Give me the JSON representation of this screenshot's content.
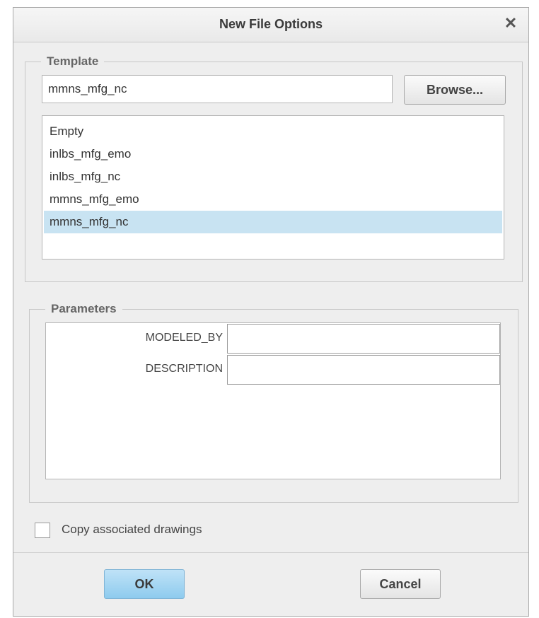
{
  "dialog": {
    "title": "New File Options",
    "close_label": "✕"
  },
  "template": {
    "group_label": "Template",
    "input_value": "mmns_mfg_nc",
    "browse_label": "Browse...",
    "items": [
      {
        "label": "Empty"
      },
      {
        "label": "inlbs_mfg_emo"
      },
      {
        "label": "inlbs_mfg_nc"
      },
      {
        "label": "mmns_mfg_emo"
      },
      {
        "label": "mmns_mfg_nc",
        "selected": true
      }
    ]
  },
  "parameters": {
    "group_label": "Parameters",
    "rows": [
      {
        "label": "MODELED_BY",
        "value": ""
      },
      {
        "label": "DESCRIPTION",
        "value": ""
      }
    ]
  },
  "options": {
    "copy_drawings_label": "Copy associated drawings",
    "copy_drawings_checked": false
  },
  "footer": {
    "ok_label": "OK",
    "cancel_label": "Cancel"
  },
  "colors": {
    "selection": "#c8e3f2",
    "ok_button": "#a6d6f3"
  }
}
